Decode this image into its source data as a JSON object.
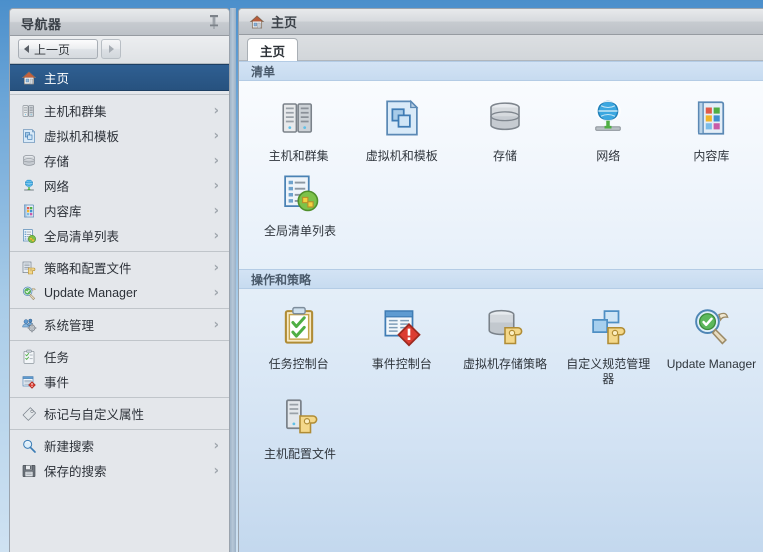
{
  "navigator": {
    "title": "导航器",
    "pin_icon": "pin-icon",
    "toolbar": {
      "back_label": "上一页",
      "back_icon": "triangle-left-icon",
      "forward_icon": "triangle-right-icon"
    },
    "items": [
      {
        "label": "主页",
        "icon": "home-icon",
        "selected": true,
        "chevron": false
      },
      {
        "label": "主机和群集",
        "icon": "hosts-clusters-icon",
        "selected": false,
        "chevron": true
      },
      {
        "label": "虚拟机和模板",
        "icon": "vms-templates-icon",
        "selected": false,
        "chevron": true
      },
      {
        "label": "存储",
        "icon": "storage-icon",
        "selected": false,
        "chevron": true
      },
      {
        "label": "网络",
        "icon": "network-icon",
        "selected": false,
        "chevron": true
      },
      {
        "label": "内容库",
        "icon": "content-library-icon",
        "selected": false,
        "chevron": true
      },
      {
        "label": "全局清单列表",
        "icon": "global-inventory-icon",
        "selected": false,
        "chevron": true
      },
      {
        "label": "策略和配置文件",
        "icon": "policies-profiles-icon",
        "selected": false,
        "chevron": true
      },
      {
        "label": "Update Manager",
        "icon": "update-manager-icon",
        "selected": false,
        "chevron": true
      },
      {
        "label": "系统管理",
        "icon": "administration-icon",
        "selected": false,
        "chevron": true
      },
      {
        "label": "任务",
        "icon": "tasks-icon",
        "selected": false,
        "chevron": false
      },
      {
        "label": "事件",
        "icon": "events-icon",
        "selected": false,
        "chevron": false
      },
      {
        "label": "标记与自定义属性",
        "icon": "tags-icon",
        "selected": false,
        "chevron": false
      },
      {
        "label": "新建搜索",
        "icon": "new-search-icon",
        "selected": false,
        "chevron": true
      },
      {
        "label": "保存的搜索",
        "icon": "saved-search-icon",
        "selected": false,
        "chevron": true
      }
    ],
    "separators_after": [
      0,
      6,
      8,
      9,
      11,
      12
    ]
  },
  "main": {
    "header": {
      "title": "主页",
      "icon": "home-icon"
    },
    "tabs": [
      {
        "label": "主页",
        "active": true
      }
    ],
    "sections": [
      {
        "title": "清单",
        "rows": [
          [
            {
              "label": "主机和群集",
              "icon": "hosts-clusters-icon"
            },
            {
              "label": "虚拟机和模板",
              "icon": "vms-templates-icon"
            },
            {
              "label": "存储",
              "icon": "storage-icon"
            },
            {
              "label": "网络",
              "icon": "network-icon"
            },
            {
              "label": "内容库",
              "icon": "content-library-icon"
            }
          ],
          [
            {
              "label": "全局清单列表",
              "icon": "global-inventory-icon"
            }
          ]
        ]
      },
      {
        "title": "操作和策略",
        "rows": [
          [
            {
              "label": "任务控制台",
              "icon": "task-console-icon"
            },
            {
              "label": "事件控制台",
              "icon": "event-console-icon"
            },
            {
              "label": "虚拟机存储策略",
              "icon": "vm-storage-policies-icon"
            },
            {
              "label": "自定义规范管理器",
              "icon": "customization-spec-icon"
            },
            {
              "label": "Update Manager",
              "icon": "update-manager-icon"
            }
          ],
          [
            {
              "label": "主机配置文件",
              "icon": "host-profiles-icon"
            }
          ]
        ]
      }
    ]
  },
  "colors": {
    "selection_blue": "#2a5584",
    "window_blue": "#6ba5d7",
    "panel_gray": "#e4e7eb",
    "section_header_blue": "#cbdff3",
    "section_label_text": "#4a5a6b"
  }
}
